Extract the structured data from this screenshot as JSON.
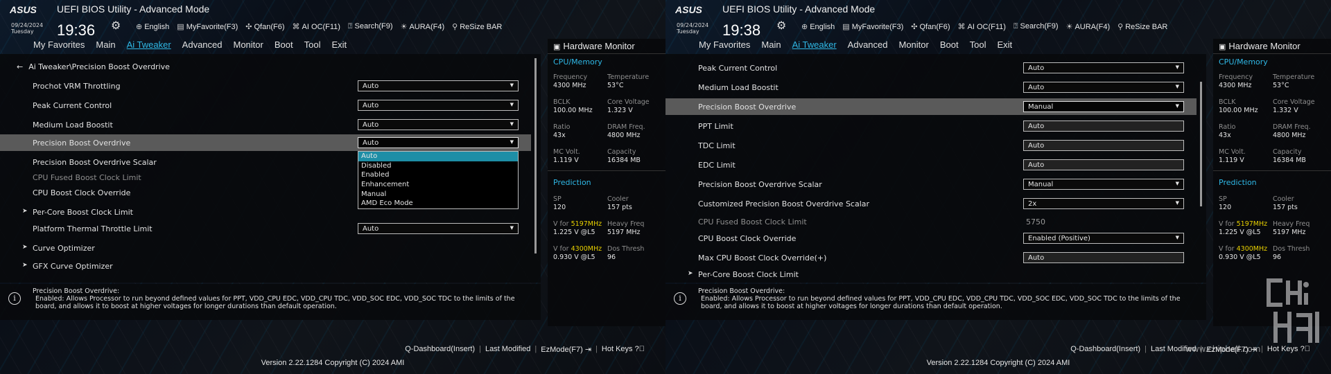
{
  "header": {
    "title": "UEFI BIOS Utility - Advanced Mode",
    "date": "09/24/2024",
    "day": "Tuesday",
    "toolbar": [
      {
        "icon": "globe-icon",
        "label": "English"
      },
      {
        "icon": "favorite-icon",
        "label": "MyFavorite(F3)"
      },
      {
        "icon": "fan-icon",
        "label": "Qfan(F6)"
      },
      {
        "icon": "ai-oc-icon",
        "label": "AI OC(F11)"
      },
      {
        "icon": "search-icon",
        "label": "Search(F9)"
      },
      {
        "icon": "aura-icon",
        "label": "AURA(F4)"
      },
      {
        "icon": "resize-icon",
        "label": "ReSize BAR"
      }
    ]
  },
  "menu": [
    "My Favorites",
    "Main",
    "Ai Tweaker",
    "Advanced",
    "Monitor",
    "Boot",
    "Tool",
    "Exit"
  ],
  "left": {
    "time": "19:36",
    "breadcrumb": "Ai Tweaker\\Precision Boost Overdrive",
    "rows": [
      {
        "label": "Prochot VRM Throttling",
        "value": "Auto"
      },
      {
        "label": "Peak Current Control",
        "value": "Auto"
      },
      {
        "label": "Medium Load Boostit",
        "value": "Auto"
      },
      {
        "label": "Precision Boost Overdrive",
        "value": "Auto"
      },
      {
        "label": "Precision Boost Overdrive Scalar"
      },
      {
        "label": "CPU Fused Boost Clock Limit"
      },
      {
        "label": "CPU Boost Clock Override"
      },
      {
        "label": "Per-Core Boost Clock Limit"
      },
      {
        "label": "Platform Thermal Throttle Limit",
        "value": "Auto"
      },
      {
        "label": "Curve Optimizer"
      },
      {
        "label": "GFX Curve Optimizer"
      }
    ],
    "dropdown": [
      "Auto",
      "Disabled",
      "Enabled",
      "Enhancement",
      "Manual",
      "AMD Eco Mode"
    ],
    "hw": {
      "cpu": {
        "frequency": "4300 MHz",
        "temperature": "53°C",
        "bclk": "100.00 MHz",
        "core_voltage": "1.323 V",
        "ratio": "43x",
        "dram_freq": "4800 MHz",
        "mc_volt": "1.119 V",
        "capacity": "16384 MB"
      },
      "pred": {
        "sp": "120",
        "cooler": "157 pts",
        "v_hi": "1.225 V @L5",
        "heavy_freq": "5197 MHz",
        "v_lo": "0.930 V @L5",
        "dos_thresh": "96"
      }
    }
  },
  "right": {
    "time": "19:38",
    "rows": [
      {
        "label": "Peak Current Control",
        "value": "Auto"
      },
      {
        "label": "Medium Load Boostit",
        "value": "Auto"
      },
      {
        "label": "Precision Boost Overdrive",
        "value": "Manual"
      },
      {
        "label": "PPT Limit",
        "value": "Auto"
      },
      {
        "label": "TDC Limit",
        "value": "Auto"
      },
      {
        "label": "EDC Limit",
        "value": "Auto"
      },
      {
        "label": "Precision Boost Overdrive Scalar",
        "value": "Manual"
      },
      {
        "label": "Customized Precision Boost Overdrive Scalar",
        "value": "2x"
      },
      {
        "label": "CPU Fused Boost Clock Limit",
        "value": "5750"
      },
      {
        "label": "CPU Boost Clock Override",
        "value": "Enabled (Positive)"
      },
      {
        "label": "Max CPU Boost Clock Override(+)",
        "value": "Auto"
      },
      {
        "label": "Per-Core Boost Clock Limit"
      }
    ],
    "hw": {
      "cpu": {
        "frequency": "4300 MHz",
        "temperature": "53°C",
        "bclk": "100.00 MHz",
        "core_voltage": "1.332 V",
        "ratio": "43x",
        "dram_freq": "4800 MHz",
        "mc_volt": "1.119 V",
        "capacity": "16384 MB"
      },
      "pred": {
        "sp": "120",
        "cooler": "157 pts",
        "v_hi": "1.225 V @L5",
        "heavy_freq": "5197 MHz",
        "v_lo": "0.930 V @L5",
        "dos_thresh": "96"
      }
    }
  },
  "hwlabels": {
    "title": "Hardware Monitor",
    "cpu_section": "CPU/Memory",
    "pred_section": "Prediction",
    "frequency": "Frequency",
    "temperature": "Temperature",
    "bclk": "BCLK",
    "core_voltage": "Core Voltage",
    "ratio": "Ratio",
    "dram_freq": "DRAM Freq.",
    "mc_volt": "MC Volt.",
    "capacity": "Capacity",
    "sp": "SP",
    "cooler": "Cooler",
    "v_for": "V for",
    "hi_mhz": "5197MHz",
    "heavy_freq": "Heavy Freq",
    "lo_mhz": "4300MHz",
    "dos_thresh": "Dos Thresh"
  },
  "info": {
    "title": "Precision Boost Overdrive:",
    "text": "Enabled: Allows Processor to run beyond defined values for PPT, VDD_CPU EDC, VDD_CPU TDC, VDD_SOC EDC, VDD_SOC TDC to the limits of the board, and allows it to boost at higher voltages for longer durations than default operation."
  },
  "footer": {
    "links": [
      "Q-Dashboard(Insert)",
      "Last Modified",
      "EzMode(F7)",
      "Hot Keys"
    ],
    "version": "Version 2.22.1284 Copyright (C) 2024 AMI"
  },
  "watermark": "www.chiphell.com",
  "colors": {
    "accent": "#2fb8e6",
    "highlight_row": "#5a5a5a",
    "selected_option": "#1e8ea6",
    "freq_yellow": "#e8d000"
  }
}
